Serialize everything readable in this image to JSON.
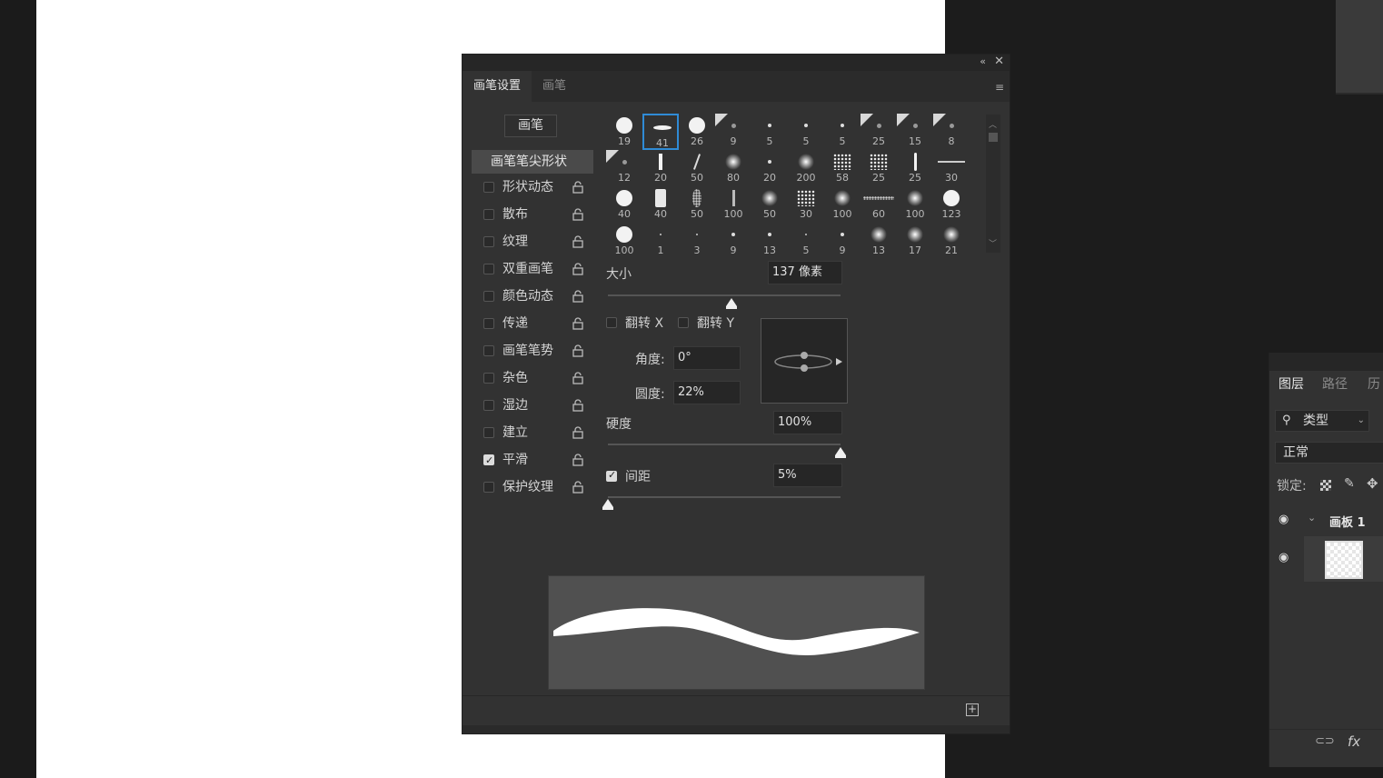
{
  "panel": {
    "tabs": [
      "画笔设置",
      "画笔"
    ],
    "brush_button": "画笔",
    "tip_shape_label": "画笔笔尖形状",
    "options": [
      {
        "label": "形状动态",
        "checked": false
      },
      {
        "label": "散布",
        "checked": false
      },
      {
        "label": "纹理",
        "checked": false
      },
      {
        "label": "双重画笔",
        "checked": false
      },
      {
        "label": "颜色动态",
        "checked": false
      },
      {
        "label": "传递",
        "checked": false
      },
      {
        "label": "画笔笔势",
        "checked": false
      },
      {
        "label": "杂色",
        "checked": false
      },
      {
        "label": "湿边",
        "checked": false
      },
      {
        "label": "建立",
        "checked": false
      },
      {
        "label": "平滑",
        "checked": true
      },
      {
        "label": "保护纹理",
        "checked": false
      }
    ],
    "brush_sizes_rows": [
      [
        "19",
        "41",
        "26",
        "9",
        "5",
        "5",
        "5",
        "25",
        "15",
        "8"
      ],
      [
        "12",
        "20",
        "50",
        "80",
        "20",
        "200",
        "58",
        "25",
        "25",
        "30"
      ],
      [
        "40",
        "40",
        "50",
        "100",
        "50",
        "30",
        "100",
        "60",
        "100",
        "123"
      ],
      [
        "100",
        "1",
        "3",
        "9",
        "13",
        "5",
        "9",
        "13",
        "17",
        "21"
      ]
    ],
    "selected_brush": "41",
    "size": {
      "label": "大小",
      "value": "137 像素",
      "fraction": 0.53
    },
    "flip_x": {
      "label": "翻转 X",
      "checked": false
    },
    "flip_y": {
      "label": "翻转 Y",
      "checked": false
    },
    "angle": {
      "label": "角度:",
      "value": "0°"
    },
    "roundness": {
      "label": "圆度:",
      "value": "22%"
    },
    "hardness": {
      "label": "硬度",
      "value": "100%",
      "fraction": 1.0
    },
    "spacing": {
      "label": "间距",
      "value": "5%",
      "checked": true,
      "fraction": 0.0
    }
  },
  "layers": {
    "tabs": [
      "图层",
      "路径",
      "历"
    ],
    "filter": "类型",
    "blend": "正常",
    "lock_label": "锁定:",
    "group_name": "画板 1",
    "fx_label": "fx"
  },
  "colors": {
    "panel_bg": "#323232",
    "accent": "#2f8bd6"
  }
}
